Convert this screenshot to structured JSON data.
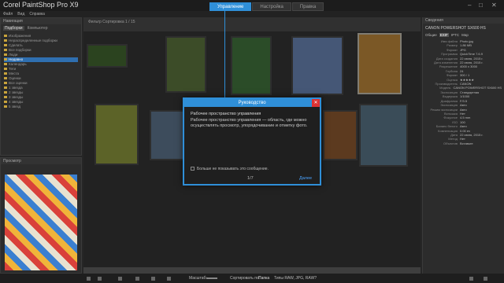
{
  "app": {
    "title": "Corel PaintShop Pro X9"
  },
  "tabs": [
    {
      "label": "Управление"
    },
    {
      "label": "Настройка"
    },
    {
      "label": "Правка"
    }
  ],
  "menu": [
    "Файл",
    "Вид",
    "Справка"
  ],
  "navigation": {
    "header": "Навигация",
    "tabs": [
      "Подборки",
      "Компьютер"
    ],
    "tree": [
      "Изображения",
      "Нераспределенные подборки",
      "Сделать",
      "Все подборки",
      "Люди",
      "Недавно",
      "Календарь",
      "Теги",
      "Места",
      "Оценки",
      "Все оценки",
      "1 звезда",
      "2 звезды",
      "3 звезды",
      "4 звезды",
      "5 звезд"
    ],
    "selected_index": 5
  },
  "preview": {
    "header": "Просмотр"
  },
  "main": {
    "toolbar": "Фильтр   Сортировка   1 / 15"
  },
  "dialog": {
    "title": "Руководство",
    "heading": "Рабочее пространство управления",
    "body": "Рабочее пространство управления — область, где можно осуществлять просмотр, упорядочивание и отметку фото.",
    "checkbox_label": "Больше не показывать это сообщение.",
    "page": "1/7",
    "next_label": "Далее"
  },
  "info": {
    "header": "Сведения",
    "camera": "CANON POWERSHOT SX600 HS",
    "tabs": [
      "Общие",
      "EXIF",
      "IPTC",
      "Map"
    ],
    "rows": [
      {
        "k": "Имя файла",
        "v": "Photo.jpg"
      },
      {
        "k": "Размер",
        "v": "1.86 MB"
      },
      {
        "k": "Формат",
        "v": "JPG"
      },
      {
        "k": "Программа",
        "v": "QuickTime 7.6.9"
      },
      {
        "k": "Дата создания",
        "v": "22 июня, 2015 г."
      },
      {
        "k": "Дата изменения",
        "v": "22 июня, 2015 г."
      },
      {
        "k": "Разрешение",
        "v": "4000 x 3000"
      },
      {
        "k": "Глубина",
        "v": "24"
      },
      {
        "k": "Формат",
        "v": "300 / 1"
      },
      {
        "k": "Оценка",
        "v": "★★★★★"
      },
      {
        "k": "Производитель",
        "v": "CANON"
      },
      {
        "k": "Модель",
        "v": "CANON POWERSHOT SX600 HS"
      },
      {
        "k": "Экспозиция",
        "v": "Стандартная"
      },
      {
        "k": "Выдержка",
        "v": "1/1000"
      },
      {
        "k": "Диафрагма",
        "v": "F/3.5"
      },
      {
        "k": "Экспозиция",
        "v": "Авто"
      },
      {
        "k": "Режим экспозиции",
        "v": "Авто"
      },
      {
        "k": "Вспышка",
        "v": "Нет"
      },
      {
        "k": "Фокусное",
        "v": "4.5 mm"
      },
      {
        "k": "ISO",
        "v": "100"
      },
      {
        "k": "Баланс белого",
        "v": "Авто"
      },
      {
        "k": "Компенсация",
        "v": "0.00 ev"
      },
      {
        "k": "Дата",
        "v": "22 июня, 2015 г."
      },
      {
        "k": "Метод",
        "v": "Нет"
      },
      {
        "k": "Объектив",
        "v": "Вставьте"
      }
    ]
  },
  "status": {
    "zoom_label": "Масштаб:",
    "sort_label": "Сортировать по:",
    "sort_value": "Папка",
    "type_label": "Типы RAW, JPG, RAW?"
  },
  "colors": {
    "accent": "#2f8fd8",
    "close": "#dd3333"
  }
}
